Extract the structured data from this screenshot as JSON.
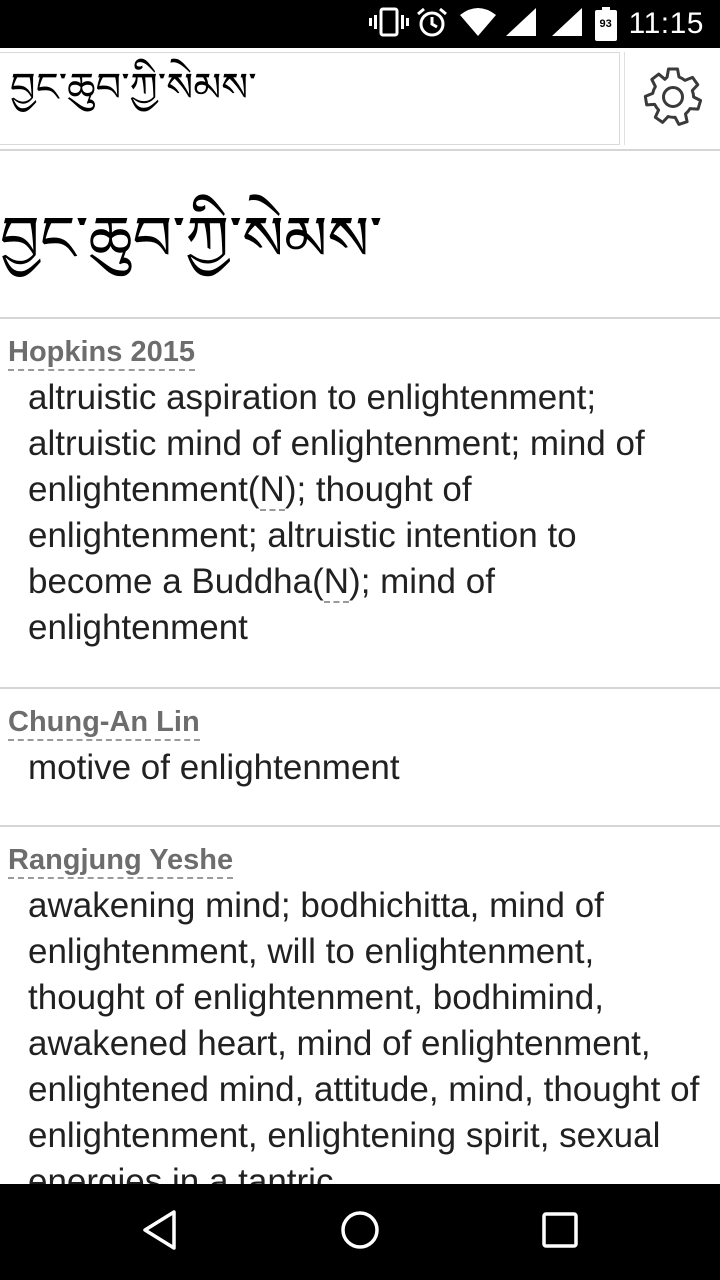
{
  "status_bar": {
    "time": "11:15",
    "battery_level": "93",
    "icons": [
      "vibrate-icon",
      "alarm-icon",
      "wifi-icon",
      "signal-icon",
      "signal-icon",
      "battery-icon"
    ]
  },
  "search": {
    "value": "བྱང་ཆུབ་ཀྱི་སེམས་",
    "settings_icon": "gear-icon"
  },
  "headword": "བྱང་ཆུབ་ཀྱི་སེམས་",
  "entries": [
    {
      "source": "Hopkins 2015",
      "def_part1": "altruistic aspiration to enlightenment; altruistic mind of enlightenment; mind of enlightenment(",
      "abbr1": "N",
      "def_part2": "); thought of enlightenment; altruistic intention to become a Buddha(",
      "abbr2": "N",
      "def_part3": "); mind of enlightenment"
    },
    {
      "source": "Chung-An Lin",
      "definition": "motive of enlightenment"
    },
    {
      "source": "Rangjung Yeshe",
      "definition": "awakening mind; bodhichitta, mind of enlightenment, will to enlightenment, thought of enlightenment, bodhimind, awakened heart, mind of enlightenment, enlightened mind, attitude, mind, thought of enlightenment, enlightening spirit, sexual energies in a tantric"
    }
  ],
  "nav_bar": {
    "icons": [
      "back-icon",
      "home-icon",
      "recents-icon"
    ]
  },
  "colors": {
    "status_bar": "#000000",
    "source_label": "#6d6d6d",
    "definition_text": "#212121",
    "divider": "#d6d6d6"
  }
}
